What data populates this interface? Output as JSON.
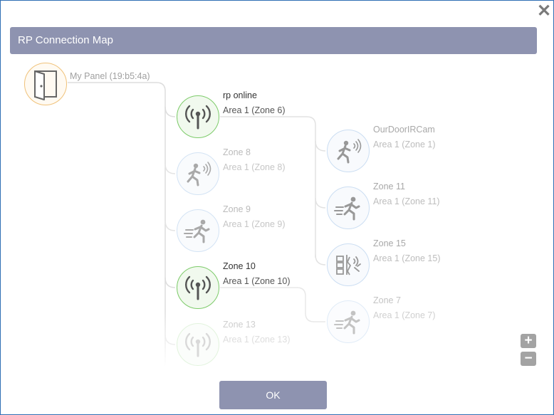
{
  "dialog": {
    "title": "RP Connection Map",
    "close_glyph": "✕",
    "ok_label": "OK"
  },
  "zoom": {
    "in_glyph": "+",
    "out_glyph": "−"
  },
  "colors": {
    "accent": "#8e93b0",
    "online_green": "#7dcb6a",
    "device_blue": "#a9c8ea",
    "panel_orange": "#f0c27a",
    "icon_gray": "#555555",
    "link_line": "#dddddd"
  },
  "nodes": {
    "panel": {
      "name": "My Panel (19:b5:4a)",
      "area": "",
      "icon": "panel-door-icon",
      "status": "panel",
      "opacity": 1
    },
    "rp_online": {
      "name": "rp online",
      "area": "Area 1 (Zone 6)",
      "icon": "antenna-icon",
      "status": "online",
      "opacity": 1
    },
    "zone8": {
      "name": "Zone 8",
      "area": "Area 1 (Zone 8)",
      "icon": "motion-sensor-icon",
      "status": "offline",
      "opacity": 0.5
    },
    "zone9": {
      "name": "Zone 9",
      "area": "Area 1 (Zone 9)",
      "icon": "runner-icon",
      "status": "offline",
      "opacity": 0.5
    },
    "zone10": {
      "name": "Zone 10",
      "area": "Area 1 (Zone 10)",
      "icon": "antenna-icon",
      "status": "online",
      "opacity": 1
    },
    "zone13": {
      "name": "Zone 13",
      "area": "Area 1 (Zone 13)",
      "icon": "antenna-icon",
      "status": "online",
      "opacity": 0.22
    },
    "ourdoor": {
      "name": "OurDoorIRCam",
      "area": "Area 1 (Zone 1)",
      "icon": "motion-sensor-icon",
      "status": "offline",
      "opacity": 0.6
    },
    "zone11": {
      "name": "Zone 11",
      "area": "Area 1 (Zone 11)",
      "icon": "runner-icon",
      "status": "offline",
      "opacity": 0.6
    },
    "zone15": {
      "name": "Zone 15",
      "area": "Area 1 (Zone 15)",
      "icon": "glass-break-icon",
      "status": "offline",
      "opacity": 0.6
    },
    "zone7": {
      "name": "Zone 7",
      "area": "Area 1 (Zone 7)",
      "icon": "runner-icon",
      "status": "offline",
      "opacity": 0.35
    }
  }
}
